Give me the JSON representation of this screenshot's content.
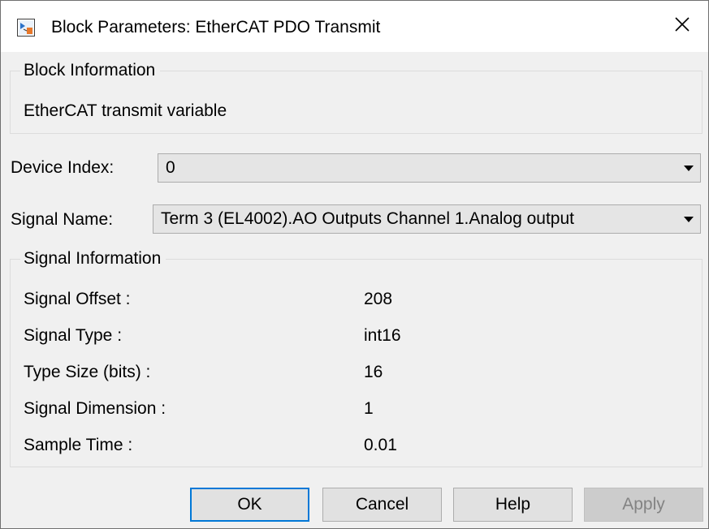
{
  "window": {
    "title": "Block Parameters: EtherCAT PDO Transmit",
    "close_glyph": "✕"
  },
  "block_info": {
    "legend": "Block Information",
    "description": "EtherCAT transmit variable"
  },
  "device_index": {
    "label": "Device Index:",
    "value": "0"
  },
  "signal_name": {
    "label": "Signal Name:",
    "value": "Term 3 (EL4002).AO Outputs Channel 1.Analog output"
  },
  "signal_info": {
    "legend": "Signal Information",
    "rows": [
      {
        "label": "Signal Offset :",
        "value": "208"
      },
      {
        "label": "Signal Type :",
        "value": "int16"
      },
      {
        "label": "Type Size (bits) :",
        "value": "16"
      },
      {
        "label": "Signal Dimension :",
        "value": "1"
      },
      {
        "label": "Sample Time :",
        "value": "0.01"
      }
    ]
  },
  "buttons": {
    "ok": "OK",
    "cancel": "Cancel",
    "help": "Help",
    "apply": "Apply"
  },
  "colors": {
    "dialog_bg": "#f0f0f0",
    "focus_border": "#0078d7",
    "disabled_text": "#838383"
  },
  "icons": {
    "title": "simulink-block-icon",
    "close": "close-icon",
    "dropdown": "chevron-down-icon"
  }
}
